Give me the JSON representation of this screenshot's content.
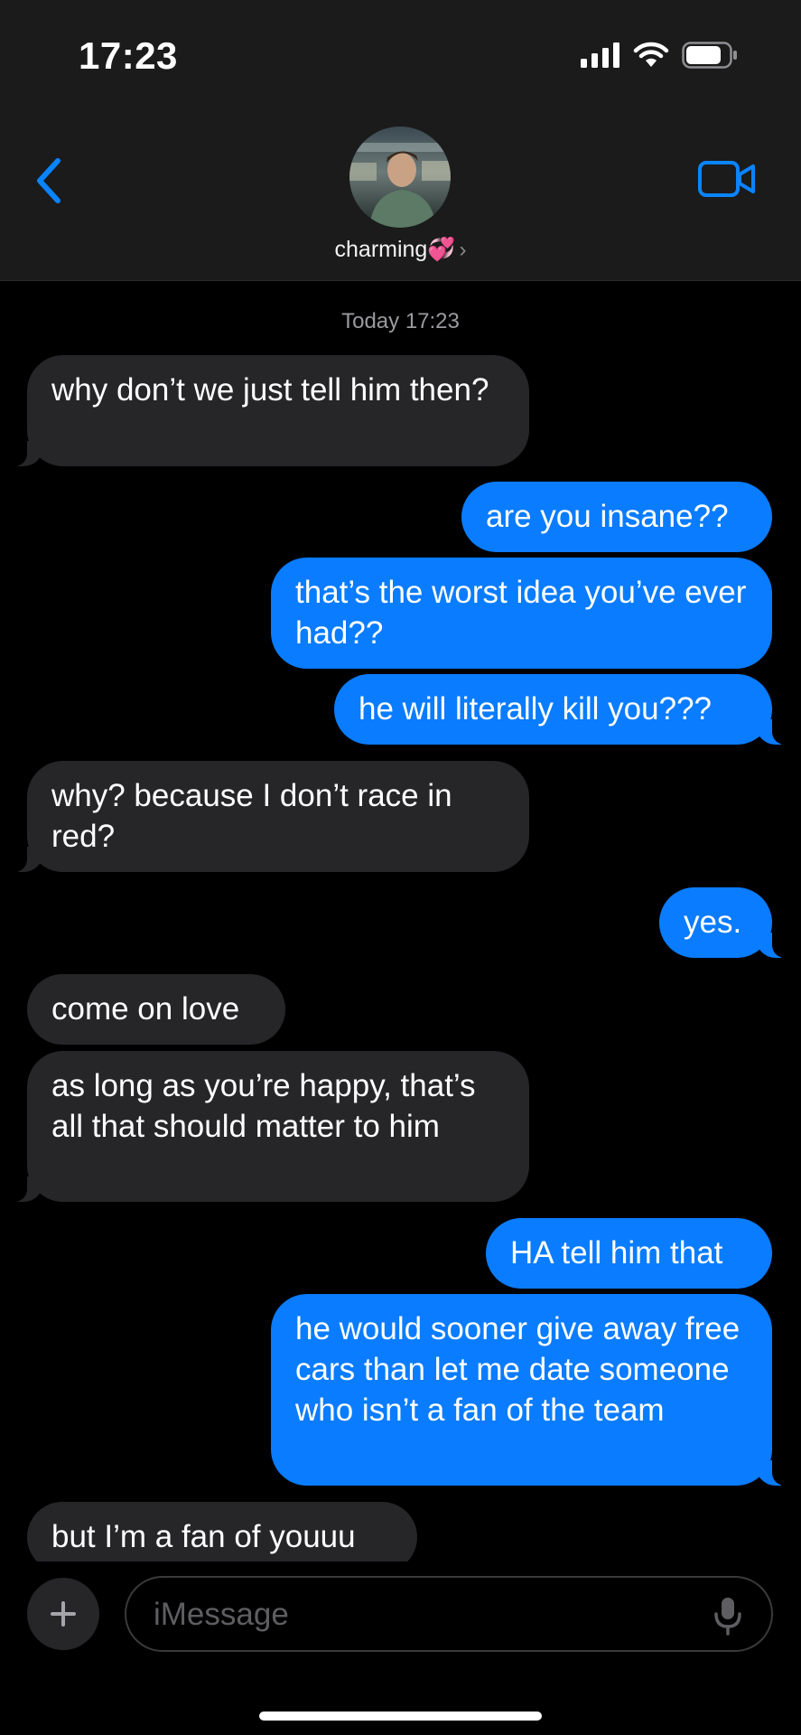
{
  "status": {
    "time": "17:23"
  },
  "header": {
    "contact_name": "charming💞",
    "chevron": "›"
  },
  "conversation": {
    "timestamp": "Today 17:23",
    "messages": [
      {
        "sender": "them",
        "text": "why don’t we just tell him then?"
      },
      {
        "sender": "me",
        "text": "are you insane??"
      },
      {
        "sender": "me",
        "text": "that’s the worst idea you’ve ever had??"
      },
      {
        "sender": "me",
        "text": "he will literally kill you???"
      },
      {
        "sender": "them",
        "text": "why? because I don’t race in red?"
      },
      {
        "sender": "me",
        "text": "yes."
      },
      {
        "sender": "them",
        "text": "come on love"
      },
      {
        "sender": "them",
        "text": "as long as you’re happy, that’s all that should matter to him"
      },
      {
        "sender": "me",
        "text": "HA tell him that"
      },
      {
        "sender": "me",
        "text": "he would sooner give away free cars than let me date someone who isn’t a fan of the team"
      },
      {
        "sender": "them",
        "text": "but I’m a fan of youuu"
      }
    ]
  },
  "composer": {
    "placeholder": "iMessage",
    "plus_icon": "plus-icon",
    "mic_icon": "microphone-icon"
  },
  "colors": {
    "outgoing": "#0a7cff",
    "incoming": "#262629",
    "accent": "#0a84ff"
  }
}
